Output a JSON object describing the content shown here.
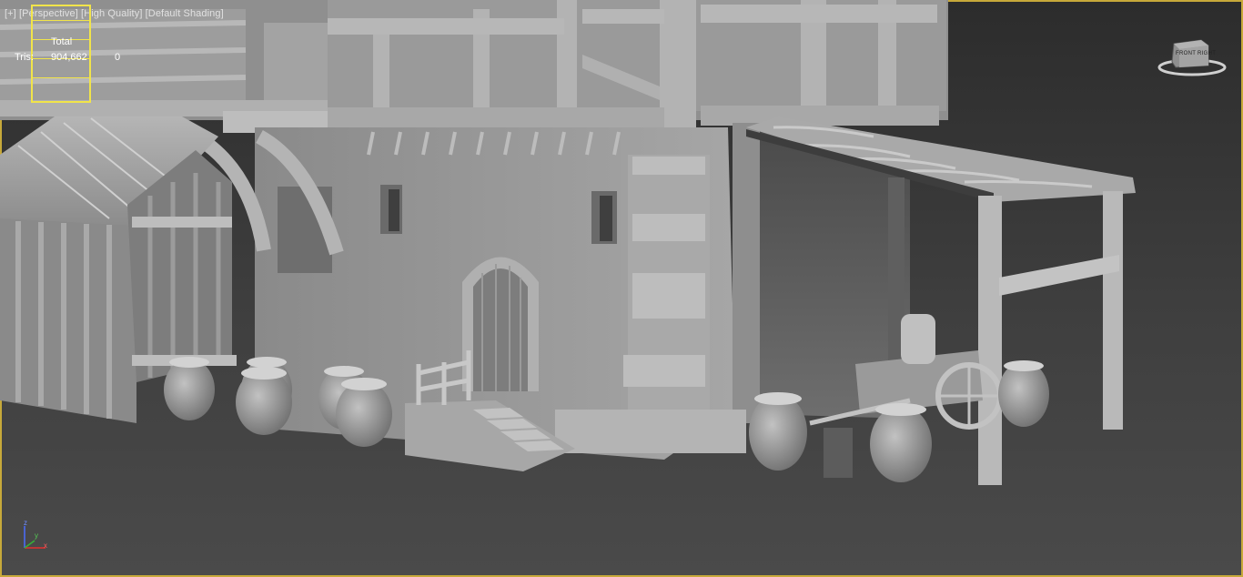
{
  "viewport": {
    "plus_menu": "[+]",
    "view_name": "Perspective",
    "quality": "High Quality",
    "shading": "Default Shading"
  },
  "stats": {
    "header": "Total",
    "tris_label": "Tris:",
    "total_value": "904,662",
    "selected_value": "0"
  },
  "viewcube": {
    "label": "FRONT  RIGHT"
  },
  "gizmo": {
    "z_label": "z",
    "x_label": "x",
    "y_label": "y"
  },
  "colors": {
    "viewport_border": "#c7a93a",
    "stats_box": "#f1e44a",
    "model_clay": "#9a9a9a",
    "label_text": "#e1e1e1"
  },
  "icons": [
    "viewcube-icon",
    "axis-gizmo-icon"
  ]
}
